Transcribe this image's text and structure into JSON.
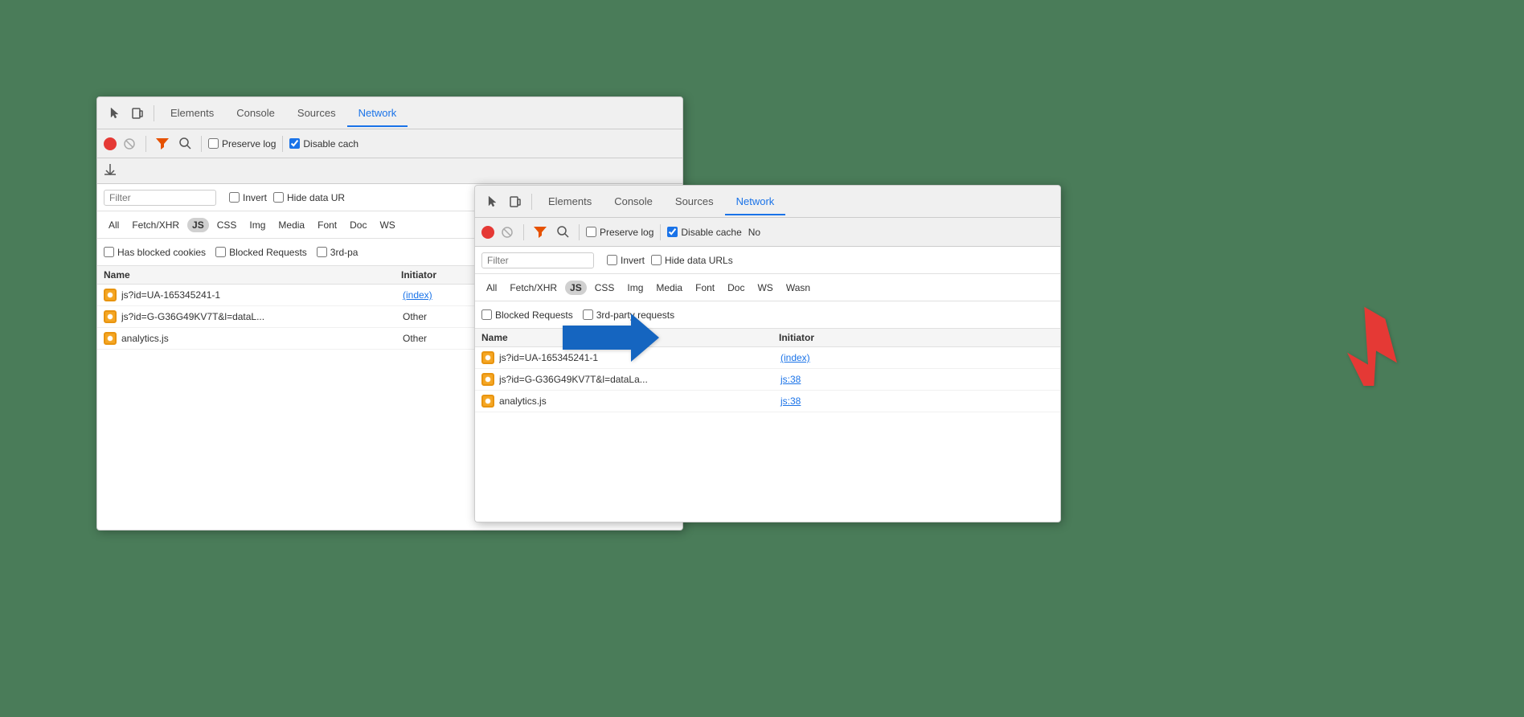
{
  "panels": {
    "left": {
      "tabs": [
        "Elements",
        "Console",
        "Sources",
        "Network"
      ],
      "active_tab": "Network",
      "toolbar": {
        "preserve_log_label": "Preserve log",
        "disable_cache_label": "Disable cach"
      },
      "filter": {
        "placeholder": "Filter",
        "invert_label": "Invert",
        "hide_data_label": "Hide data UR"
      },
      "type_filters": [
        "All",
        "Fetch/XHR",
        "JS",
        "CSS",
        "Img",
        "Media",
        "Font",
        "Doc",
        "WS"
      ],
      "cookie_filters": [
        "Has blocked cookies",
        "Blocked Requests",
        "3rd-pa"
      ],
      "table": {
        "col_name": "Name",
        "col_initiator": "Initiator",
        "rows": [
          {
            "name": "js?id=UA-165345241-1",
            "initiator": "(index)",
            "initiator_link": true
          },
          {
            "name": "js?id=G-G36G49KV7T&l=dataL...",
            "initiator": "Other",
            "initiator_link": false
          },
          {
            "name": "analytics.js",
            "initiator": "Other",
            "initiator_link": false
          }
        ]
      }
    },
    "right": {
      "tabs": [
        "Elements",
        "Console",
        "Sources",
        "Network"
      ],
      "active_tab": "Network",
      "toolbar": {
        "preserve_log_label": "Preserve log",
        "disable_cache_label": "Disable cache",
        "extra": "No"
      },
      "filter": {
        "placeholder": "Filter",
        "invert_label": "Invert",
        "hide_data_label": "Hide data URLs"
      },
      "type_filters": [
        "All",
        "Fetch/XHR",
        "JS",
        "CSS",
        "Img",
        "Media",
        "Font",
        "Doc",
        "WS",
        "Wasn"
      ],
      "cookie_filters": [
        "Blocked Requests",
        "3rd-party requests"
      ],
      "table": {
        "col_name": "Name",
        "col_initiator": "Initiator",
        "rows": [
          {
            "name": "js?id=UA-165345241-1",
            "initiator": "(index)",
            "initiator_link": true,
            "has_red_arrow": true
          },
          {
            "name": "js?id=G-G36G49KV7T&l=dataLa...",
            "initiator": "js:38",
            "initiator_link": true,
            "has_red_arrow": false
          },
          {
            "name": "analytics.js",
            "initiator": "js:38",
            "initiator_link": true,
            "has_red_arrow": false
          }
        ]
      }
    }
  }
}
